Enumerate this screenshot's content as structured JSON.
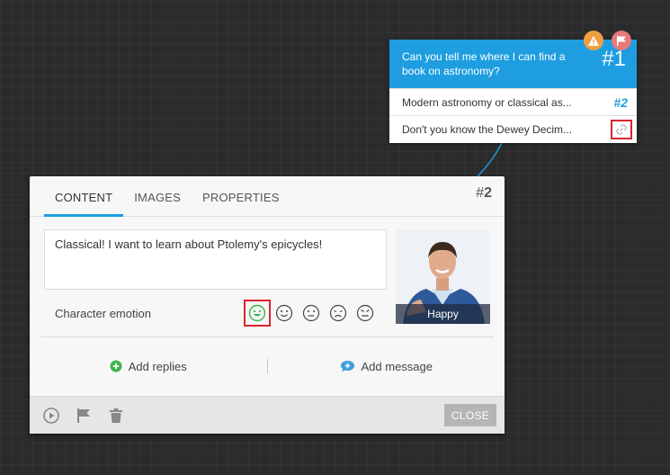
{
  "node": {
    "question": "Can you tell me where I can find a book on astronomy?",
    "id": "#1",
    "replies": [
      {
        "text": "Modern astronomy or classical as...",
        "ref": "#2"
      },
      {
        "text": "Don't you know the Dewey Decim...",
        "icon": "link-icon"
      }
    ],
    "badges": [
      "warning-icon",
      "flag-icon"
    ]
  },
  "panel": {
    "tabs": [
      "CONTENT",
      "IMAGES",
      "PROPERTIES"
    ],
    "active_tab": "CONTENT",
    "id_prefix": "#",
    "id_number": "2",
    "message": "Classical! I want to learn about Ptolemy's epicycles!",
    "emotion_label": "Character emotion",
    "emotions": [
      "happy-face-icon",
      "smile-face-icon",
      "neutral-face-icon",
      "sad-face-icon",
      "angry-face-icon"
    ],
    "selected_emotion": "Happy",
    "portrait_caption": "Happy",
    "add_replies": "Add replies",
    "add_message": "Add message",
    "close": "CLOSE"
  },
  "colors": {
    "accent": "#1e9ee0",
    "highlight": "#d9262d",
    "happy": "#3cb54a",
    "warning": "#f0a043",
    "flag": "#e87a7a"
  }
}
